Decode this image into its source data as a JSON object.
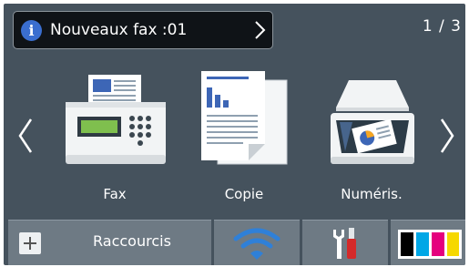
{
  "notification": {
    "text": "Nouveaux fax :01",
    "icon": "info-icon"
  },
  "page_indicator": "1 / 3",
  "functions": [
    {
      "id": "fax",
      "label": "Fax",
      "icon": "fax-machine-icon"
    },
    {
      "id": "copy",
      "label": "Copie",
      "icon": "copy-documents-icon"
    },
    {
      "id": "scan",
      "label": "Numéris.",
      "icon": "scanner-icon"
    }
  ],
  "navigation": {
    "prev_icon": "chevron-left-icon",
    "next_icon": "chevron-right-icon"
  },
  "bottom_bar": {
    "shortcuts_label": "Raccourcis",
    "shortcuts_icon": "plus-icon",
    "wifi_icon": "wifi-icon",
    "settings_icon": "tools-settings-icon",
    "ink_icon": "ink-levels-icon"
  },
  "colors": {
    "background": "#45525d",
    "button": "#6e7a84",
    "info_blue": "#3a6ecf",
    "wifi_blue": "#2f80d8",
    "ink_black": "#000000",
    "ink_cyan": "#00a7e6",
    "ink_magenta": "#e5007e",
    "ink_yellow": "#f6d800"
  }
}
